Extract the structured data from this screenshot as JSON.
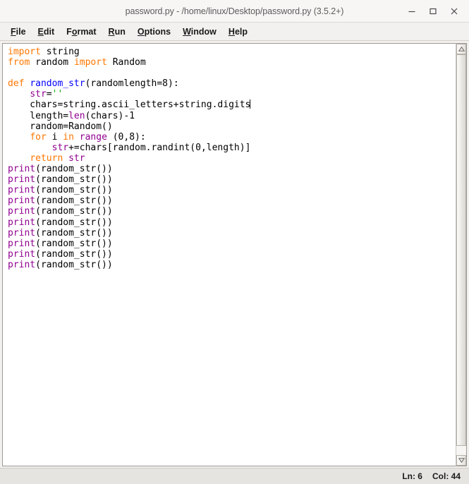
{
  "window": {
    "title": "password.py - /home/linux/Desktop/password.py (3.5.2+)",
    "controls": {
      "minimize": "minimize",
      "maximize": "maximize",
      "close": "close"
    }
  },
  "menubar": {
    "items": [
      {
        "label": "File",
        "mnemonic": "F",
        "pre": "",
        "post": "ile"
      },
      {
        "label": "Edit",
        "mnemonic": "E",
        "pre": "",
        "post": "dit"
      },
      {
        "label": "Format",
        "mnemonic": "o",
        "pre": "F",
        "post": "rmat"
      },
      {
        "label": "Run",
        "mnemonic": "R",
        "pre": "",
        "post": "un"
      },
      {
        "label": "Options",
        "mnemonic": "O",
        "pre": "",
        "post": "ptions"
      },
      {
        "label": "Window",
        "mnemonic": "W",
        "pre": "",
        "post": "indow"
      },
      {
        "label": "Help",
        "mnemonic": "H",
        "pre": "",
        "post": "elp"
      }
    ]
  },
  "editor": {
    "language": "python",
    "cursor_line": 6,
    "cursor_col": 44,
    "colors": {
      "keyword": "#ff7700",
      "builtin": "#900090",
      "definition": "#0000ff",
      "string": "#00aa00",
      "normal": "#000000",
      "background": "#ffffff"
    },
    "lines": [
      {
        "n": 1,
        "tokens": [
          {
            "t": "import",
            "c": "kw"
          },
          {
            "t": " string",
            "c": ""
          }
        ]
      },
      {
        "n": 2,
        "tokens": [
          {
            "t": "from",
            "c": "kw"
          },
          {
            "t": " random ",
            "c": ""
          },
          {
            "t": "import",
            "c": "kw"
          },
          {
            "t": " Random",
            "c": ""
          }
        ]
      },
      {
        "n": 3,
        "tokens": []
      },
      {
        "n": 4,
        "tokens": [
          {
            "t": "def",
            "c": "kw"
          },
          {
            "t": " ",
            "c": ""
          },
          {
            "t": "random_str",
            "c": "fn"
          },
          {
            "t": "(randomlength=8):",
            "c": ""
          }
        ]
      },
      {
        "n": 5,
        "tokens": [
          {
            "t": "    ",
            "c": ""
          },
          {
            "t": "str",
            "c": "bi"
          },
          {
            "t": "=",
            "c": ""
          },
          {
            "t": "''",
            "c": "st"
          }
        ]
      },
      {
        "n": 6,
        "tokens": [
          {
            "t": "    chars=string.ascii_letters+string.digits",
            "c": ""
          }
        ],
        "caret": true
      },
      {
        "n": 7,
        "tokens": [
          {
            "t": "    length=",
            "c": ""
          },
          {
            "t": "len",
            "c": "bi"
          },
          {
            "t": "(chars)-1",
            "c": ""
          }
        ]
      },
      {
        "n": 8,
        "tokens": [
          {
            "t": "    random=Random()",
            "c": ""
          }
        ]
      },
      {
        "n": 9,
        "tokens": [
          {
            "t": "    ",
            "c": ""
          },
          {
            "t": "for",
            "c": "kw"
          },
          {
            "t": " i ",
            "c": ""
          },
          {
            "t": "in",
            "c": "kw"
          },
          {
            "t": " ",
            "c": ""
          },
          {
            "t": "range",
            "c": "bi"
          },
          {
            "t": " (0,8):",
            "c": ""
          }
        ]
      },
      {
        "n": 10,
        "tokens": [
          {
            "t": "        ",
            "c": ""
          },
          {
            "t": "str",
            "c": "bi"
          },
          {
            "t": "+=chars[random.randint(0,length)]",
            "c": ""
          }
        ]
      },
      {
        "n": 11,
        "tokens": [
          {
            "t": "    ",
            "c": ""
          },
          {
            "t": "return",
            "c": "kw"
          },
          {
            "t": " ",
            "c": ""
          },
          {
            "t": "str",
            "c": "bi"
          }
        ]
      },
      {
        "n": 12,
        "tokens": [
          {
            "t": "print",
            "c": "bi"
          },
          {
            "t": "(random_str())",
            "c": ""
          }
        ]
      },
      {
        "n": 13,
        "tokens": [
          {
            "t": "print",
            "c": "bi"
          },
          {
            "t": "(random_str())",
            "c": ""
          }
        ]
      },
      {
        "n": 14,
        "tokens": [
          {
            "t": "print",
            "c": "bi"
          },
          {
            "t": "(random_str())",
            "c": ""
          }
        ]
      },
      {
        "n": 15,
        "tokens": [
          {
            "t": "print",
            "c": "bi"
          },
          {
            "t": "(random_str())",
            "c": ""
          }
        ]
      },
      {
        "n": 16,
        "tokens": [
          {
            "t": "print",
            "c": "bi"
          },
          {
            "t": "(random_str())",
            "c": ""
          }
        ]
      },
      {
        "n": 17,
        "tokens": [
          {
            "t": "print",
            "c": "bi"
          },
          {
            "t": "(random_str())",
            "c": ""
          }
        ]
      },
      {
        "n": 18,
        "tokens": [
          {
            "t": "print",
            "c": "bi"
          },
          {
            "t": "(random_str())",
            "c": ""
          }
        ]
      },
      {
        "n": 19,
        "tokens": [
          {
            "t": "print",
            "c": "bi"
          },
          {
            "t": "(random_str())",
            "c": ""
          }
        ]
      },
      {
        "n": 20,
        "tokens": [
          {
            "t": "print",
            "c": "bi"
          },
          {
            "t": "(random_str())",
            "c": ""
          }
        ]
      },
      {
        "n": 21,
        "tokens": [
          {
            "t": "print",
            "c": "bi"
          },
          {
            "t": "(random_str())",
            "c": ""
          }
        ]
      }
    ]
  },
  "scrollbar": {
    "up_arrow": "scroll-up-arrow",
    "down_arrow": "scroll-down-arrow"
  },
  "statusbar": {
    "line_label": "Ln: 6",
    "col_label": "Col: 44"
  }
}
